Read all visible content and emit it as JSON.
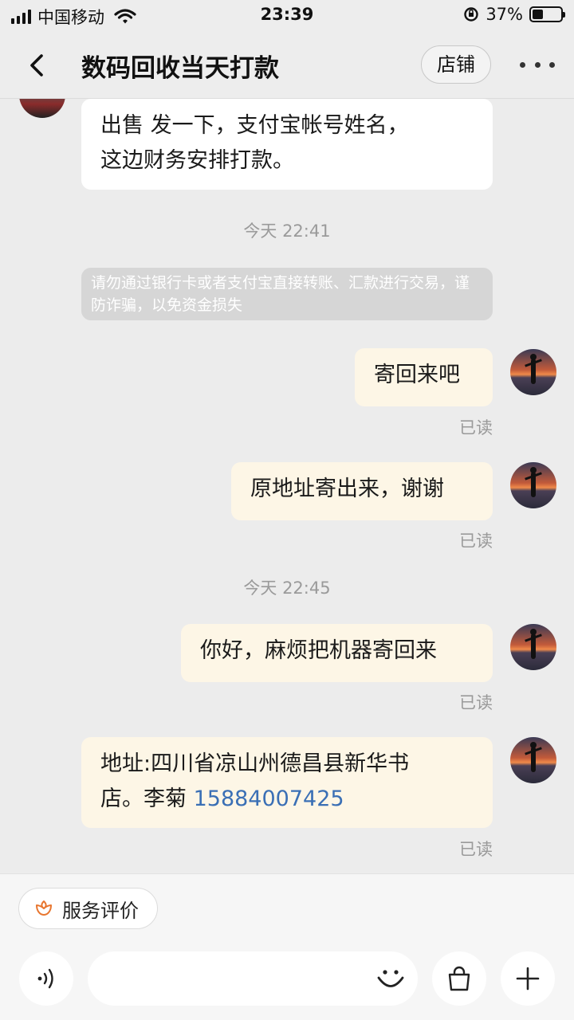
{
  "status_bar": {
    "carrier": "中国移动",
    "time": "23:39",
    "battery_percent": "37%",
    "battery_level": 0.37
  },
  "nav": {
    "title": "数码回收当天打款",
    "shop_button": "店铺"
  },
  "messages": {
    "m1": {
      "line1": "出售 发一下，支付宝帐号姓名，",
      "line2": "这边财务安排打款。"
    },
    "ts1": "今天 22:41",
    "warning": "请勿通过银行卡或者支付宝直接转账、汇款进行交易，谨防诈骗，以免资金损失",
    "m2": "寄回来吧",
    "m2_status": "已读",
    "m3": "原地址寄出来，谢谢",
    "m3_status": "已读",
    "ts2": "今天 22:45",
    "m4": "你好，麻烦把机器寄回来",
    "m4_status": "已读",
    "m5": {
      "line1": "地址:四川省凉山州德昌县新华书",
      "line2_prefix": "店。李菊 ",
      "phone": "15884007425"
    },
    "m5_status": "已读"
  },
  "bottom": {
    "service_chip": "服务评价",
    "input_placeholder": ""
  },
  "colors": {
    "phone_link": "#3a6fb5",
    "outgoing_bubble": "#fdf6e6",
    "service_icon": "#e8762f"
  },
  "icons": [
    "signal-icon",
    "wifi-icon",
    "rotation-lock-icon",
    "battery-icon",
    "back-arrow-icon",
    "more-icon",
    "flower-icon",
    "voice-icon",
    "emoji-icon",
    "shopping-bag-icon",
    "plus-icon"
  ]
}
